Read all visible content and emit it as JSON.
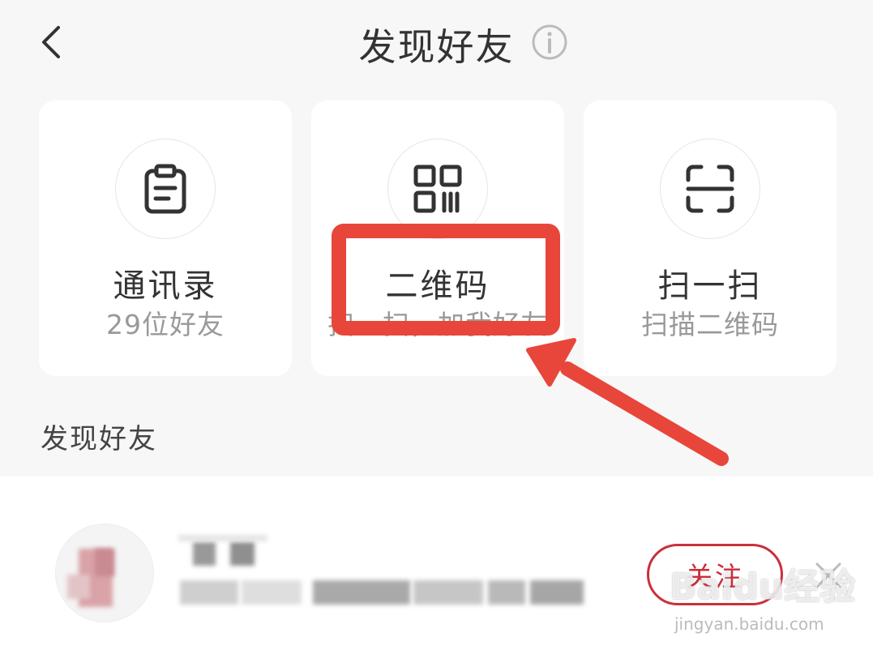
{
  "header": {
    "title": "发现好友",
    "back_icon": "chevron-left-icon",
    "info_icon": "info-icon"
  },
  "cards": [
    {
      "icon": "clipboard-icon",
      "title": "通讯录",
      "subtitle": "29位好友"
    },
    {
      "icon": "qr-code-icon",
      "title": "二维码",
      "subtitle": "扫一扫，加我好友"
    },
    {
      "icon": "scan-icon",
      "title": "扫一扫",
      "subtitle": "扫描二维码"
    }
  ],
  "section": {
    "label": "发现好友"
  },
  "suggestion": {
    "follow_label": "关注",
    "dismiss_icon": "close-icon"
  },
  "annotation": {
    "color": "#e8463a",
    "highlight_target": "二维码"
  },
  "watermark": {
    "brand": "Baidu经验",
    "url": "jingyan.baidu.com"
  },
  "colors": {
    "accent": "#c8303c",
    "background": "#f7f7f7",
    "card": "#ffffff"
  }
}
